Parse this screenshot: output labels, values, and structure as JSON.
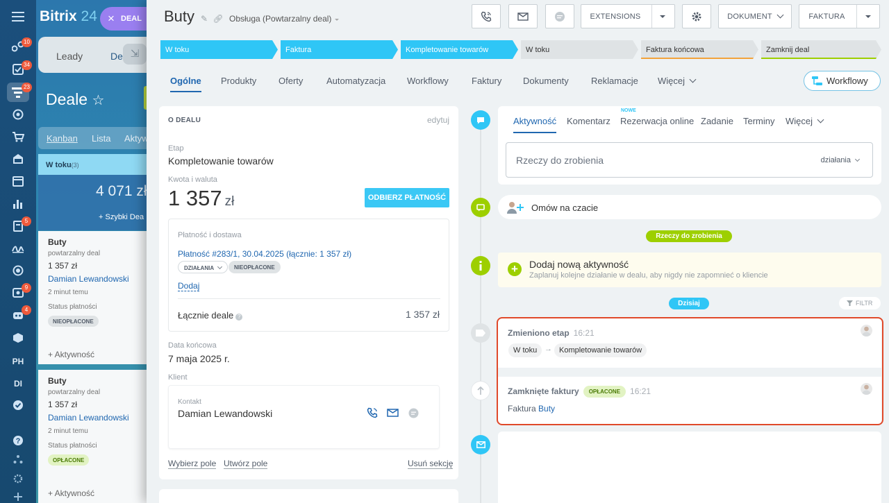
{
  "rail": {
    "badges": [
      "10",
      "34",
      "23",
      "5",
      "9",
      "4"
    ],
    "text_items": [
      "PH",
      "DI"
    ]
  },
  "background": {
    "logo_main": "Bitrix",
    "logo_num": "24",
    "deal_button": "DEAL",
    "tabs": [
      "Leady",
      "De"
    ],
    "page_title": "Deale",
    "views": [
      "Kanban",
      "Lista",
      "Aktyw"
    ],
    "column": {
      "name": "W toku",
      "count": "(3)",
      "sum": "4 071 zł",
      "quick_add": "+ Szybki Dea"
    },
    "cards": [
      {
        "title": "Buty",
        "subtitle": "powtarzalny deal",
        "price": "1 357 zł",
        "contact": "Damian Lewandowski",
        "time": "2 minut temu",
        "status_label": "Status płatności",
        "status": "NIEOPŁACONE",
        "activity": "+ Aktywność"
      },
      {
        "title": "Buty",
        "subtitle": "powtarzalny deal",
        "price": "1 357 zł",
        "contact": "Damian Lewandowski",
        "time": "2 minut temu",
        "status_label": "Status płatności",
        "status": "OPŁACONE",
        "activity": "+ Aktywność"
      }
    ]
  },
  "header": {
    "title": "Buty",
    "category": "Obsługa (Powtarzalny deal)",
    "extensions": "EXTENSIONS",
    "dokument": "DOKUMENT",
    "faktura": "FAKTURA"
  },
  "stages": [
    {
      "label": "W toku",
      "active": true,
      "underline": ""
    },
    {
      "label": "Faktura",
      "active": true,
      "underline": ""
    },
    {
      "label": "Kompletowanie towarów",
      "active": true,
      "underline": ""
    },
    {
      "label": "W toku",
      "active": false,
      "underline": ""
    },
    {
      "label": "Faktura końcowa",
      "active": false,
      "underline": "#f2a33a"
    },
    {
      "label": "Zamknij deal",
      "active": false,
      "underline": "#9dcf00"
    }
  ],
  "tabs": [
    "Ogólne",
    "Produkty",
    "Oferty",
    "Automatyzacja",
    "Workflowy",
    "Faktury",
    "Dokumenty",
    "Reklamacje",
    "Więcej"
  ],
  "workflow_button": "Workflowy",
  "about": {
    "heading": "O DEALU",
    "edit": "edytuj",
    "stage_label": "Etap",
    "stage_value": "Kompletowanie towarów",
    "amount_label": "Kwota i waluta",
    "amount": "1 357",
    "currency": "zł",
    "pay_button": "ODBIERZ PŁATNOŚĆ",
    "payment": {
      "heading": "Płatność i dostawa",
      "link": "Płatność #283/1, 30.04.2025 (łącznie: 1 357 zł)",
      "actions": "DZIAŁANIA",
      "status": "NIEOPŁACONE",
      "add": "Dodaj",
      "total_label": "Łącznie deale",
      "total_value": "1 357 zł"
    },
    "end_date_label": "Data końcowa",
    "end_date": "7 maja 2025 r.",
    "client_label": "Klient",
    "contact_label": "Kontakt",
    "contact_name": "Damian Lewandowski",
    "footer": [
      "Wybierz pole",
      "Utwórz pole",
      "Usuń sekcję"
    ]
  },
  "timeline": {
    "editor_tabs": [
      "Aktywność",
      "Komentarz",
      "Rezerwacja online",
      "Zadanie",
      "Terminy",
      "Więcej"
    ],
    "new_badge": "NOWE",
    "todo_placeholder": "Rzeczy do zrobienia",
    "todo_actions": "działania",
    "chat": "Omów na czacie",
    "todo_section": "Rzeczy do zrobienia",
    "add_activity_title": "Dodaj nową aktywność",
    "add_activity_sub": "Zaplanuj kolejne działanie w dealu, aby nigdy nie zapomnieć o kliencie",
    "today": "Dzisiaj",
    "filter": "FILTR",
    "items": [
      {
        "title": "Zmieniono etap",
        "time": "16:21",
        "from": "W toku",
        "to": "Kompletowanie towarów"
      },
      {
        "title": "Zamknięte faktury",
        "badge": "OPŁACONE",
        "time": "16:21",
        "text": "Faktura",
        "link": "Buty"
      }
    ]
  },
  "colors": {
    "accent": "#2fc6f6",
    "link": "#2067b0",
    "green": "#9dcf00",
    "highlight": "#e0492a"
  }
}
